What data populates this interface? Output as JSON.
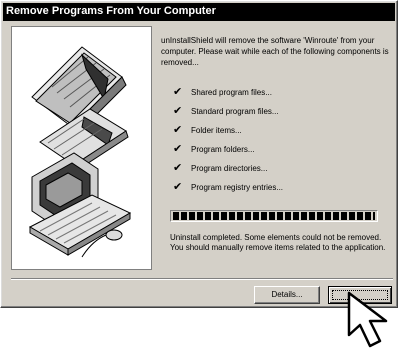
{
  "window": {
    "title": "Remove Programs From Your Computer"
  },
  "intro_text": "unInstallShield will remove the software 'Winroute' from your computer.  Please wait while each of the following components is removed...",
  "steps": [
    {
      "label": "Shared program files..."
    },
    {
      "label": "Standard program files..."
    },
    {
      "label": "Folder items..."
    },
    {
      "label": "Program folders..."
    },
    {
      "label": "Program directories..."
    },
    {
      "label": "Program registry entries..."
    }
  ],
  "check_glyph": "✔",
  "progress": {
    "fraction": 1.0
  },
  "status_text": "Uninstall completed.  Some elements could not be removed.  You should manually remove items related to the application.",
  "buttons": {
    "details_label": "Details...",
    "finish_label": ""
  },
  "icons": {
    "side_panel": "computer-documents-illustration",
    "check": "check-icon",
    "cursor": "arrow-cursor-icon"
  }
}
